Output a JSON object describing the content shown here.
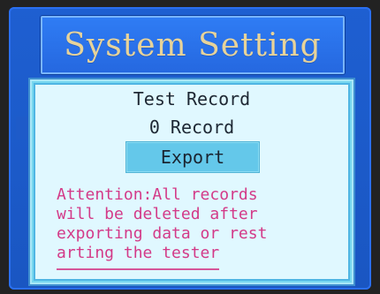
{
  "screen": {
    "header": {
      "title": "System Setting"
    },
    "panel": {
      "title": "Test Record",
      "record_count": "0 Record",
      "export_label": "Export",
      "attention_text": "Attention:All records\nwill be deleted after\nexporting data or rest\narting the tester"
    }
  },
  "colors": {
    "screen_blue": "#1e5fd1",
    "header_blue": "#2f7cf4",
    "header_text": "#e7d39a",
    "panel_cyan": "#78d7ef",
    "panel_inner": "#e0f8ff",
    "button_cyan": "#64c8ea",
    "attention_pink": "#d33a88"
  }
}
